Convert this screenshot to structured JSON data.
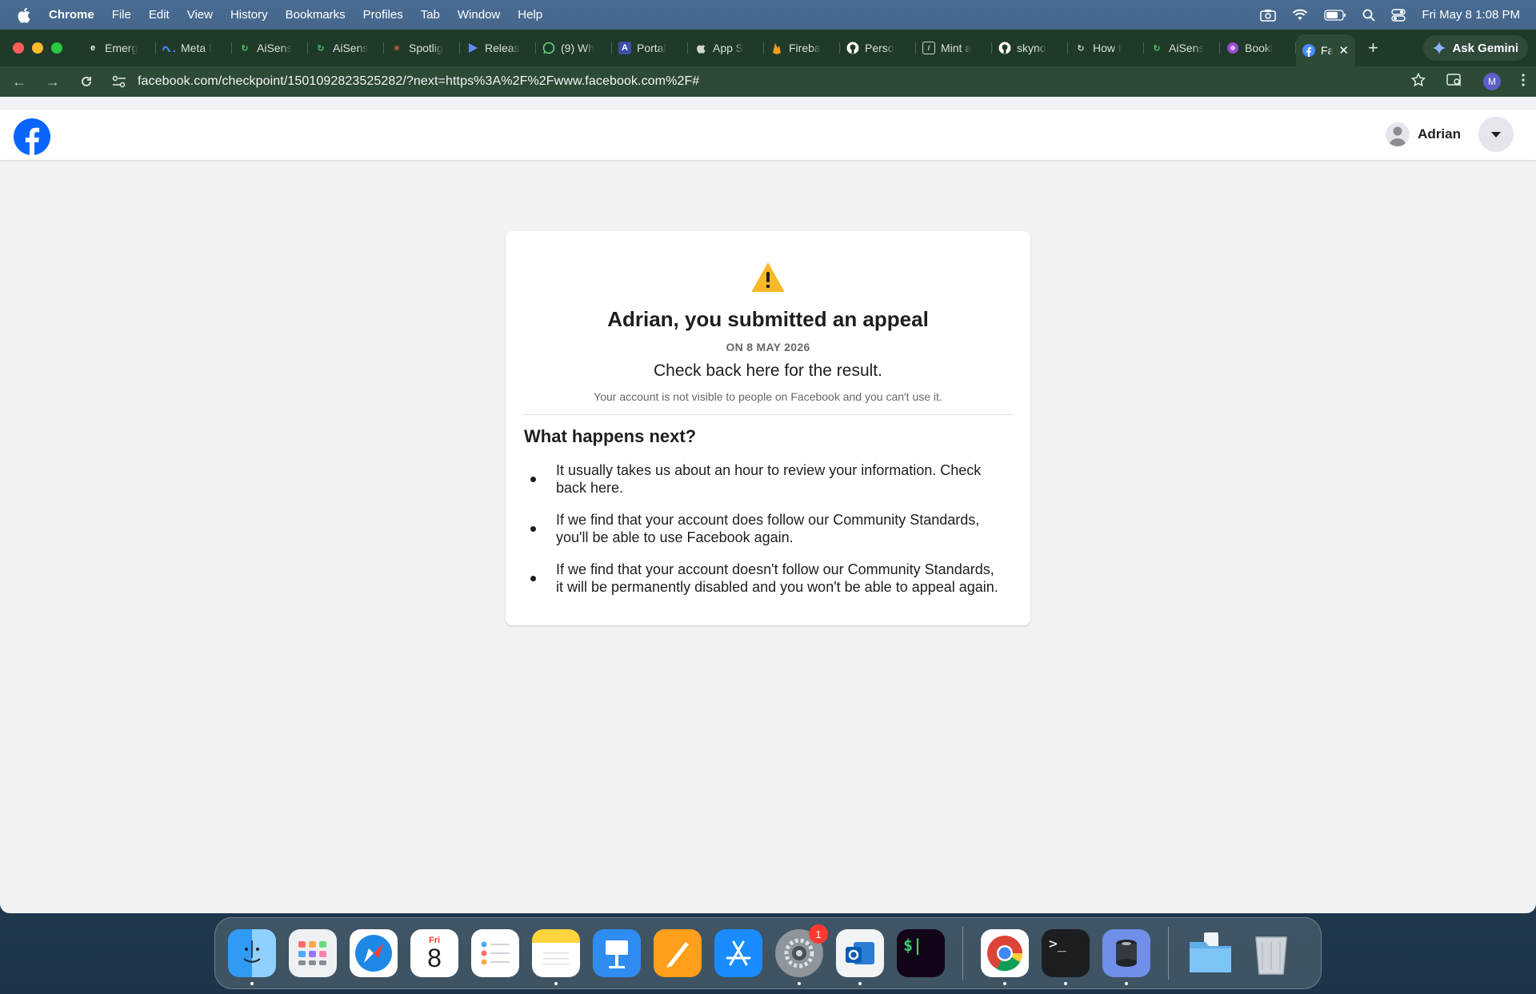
{
  "menubar": {
    "app_name": "Chrome",
    "menus": [
      "File",
      "Edit",
      "View",
      "History",
      "Bookmarks",
      "Profiles",
      "Tab",
      "Window",
      "Help"
    ],
    "clock": "Fri May 8  1:08 PM"
  },
  "browser": {
    "tabs": [
      {
        "label": "Emerg",
        "icon": "emergent-icon"
      },
      {
        "label": "Meta f",
        "icon": "meta-icon"
      },
      {
        "label": "AiSens",
        "icon": "aisens-icon"
      },
      {
        "label": "AiSens",
        "icon": "aisens-icon"
      },
      {
        "label": "Spotlig",
        "icon": "spotlight-icon"
      },
      {
        "label": "Releas",
        "icon": "release-icon"
      },
      {
        "label": "(9) Wh",
        "icon": "whatsapp-icon"
      },
      {
        "label": "Portal",
        "icon": "portal-icon"
      },
      {
        "label": "App S",
        "icon": "apple-icon"
      },
      {
        "label": "Fireba",
        "icon": "firebase-icon"
      },
      {
        "label": "Perso",
        "icon": "github-icon"
      },
      {
        "label": "Mint a",
        "icon": "mint-icon"
      },
      {
        "label": "skyno",
        "icon": "github-icon"
      },
      {
        "label": "How t",
        "icon": "howto-icon"
      },
      {
        "label": "AiSens",
        "icon": "aisens-icon"
      },
      {
        "label": "Bookl",
        "icon": "booklet-icon"
      }
    ],
    "active_tab": {
      "label": "Fa",
      "icon": "facebook-icon"
    },
    "ask_gemini": "Ask Gemini",
    "url": "facebook.com/checkpoint/1501092823525282/?next=https%3A%2F%2Fwww.facebook.com%2F#",
    "profile_initial": "M"
  },
  "facebook": {
    "user_name": "Adrian",
    "card": {
      "title": "Adrian, you submitted an appeal",
      "date": "ON 8 MAY 2026",
      "check_back": "Check back here for the result.",
      "note": "Your account is not visible to people on Facebook and you can't use it.",
      "next_title": "What happens next?",
      "bullets": [
        "It usually takes us about an hour to review your information. Check back here.",
        "If we find that your account does follow our Community Standards, you'll be able to use Facebook again.",
        "If we find that your account doesn't follow our Community Standards, it will be permanently disabled and you won't be able to appeal again."
      ]
    }
  },
  "dock": {
    "calendar_day": "Fri",
    "calendar_date": "8",
    "settings_badge": "1"
  },
  "colors": {
    "facebook_blue": "#0866ff",
    "warning_yellow": "#f7b928",
    "chrome_dark_green": "#2d4a37"
  }
}
